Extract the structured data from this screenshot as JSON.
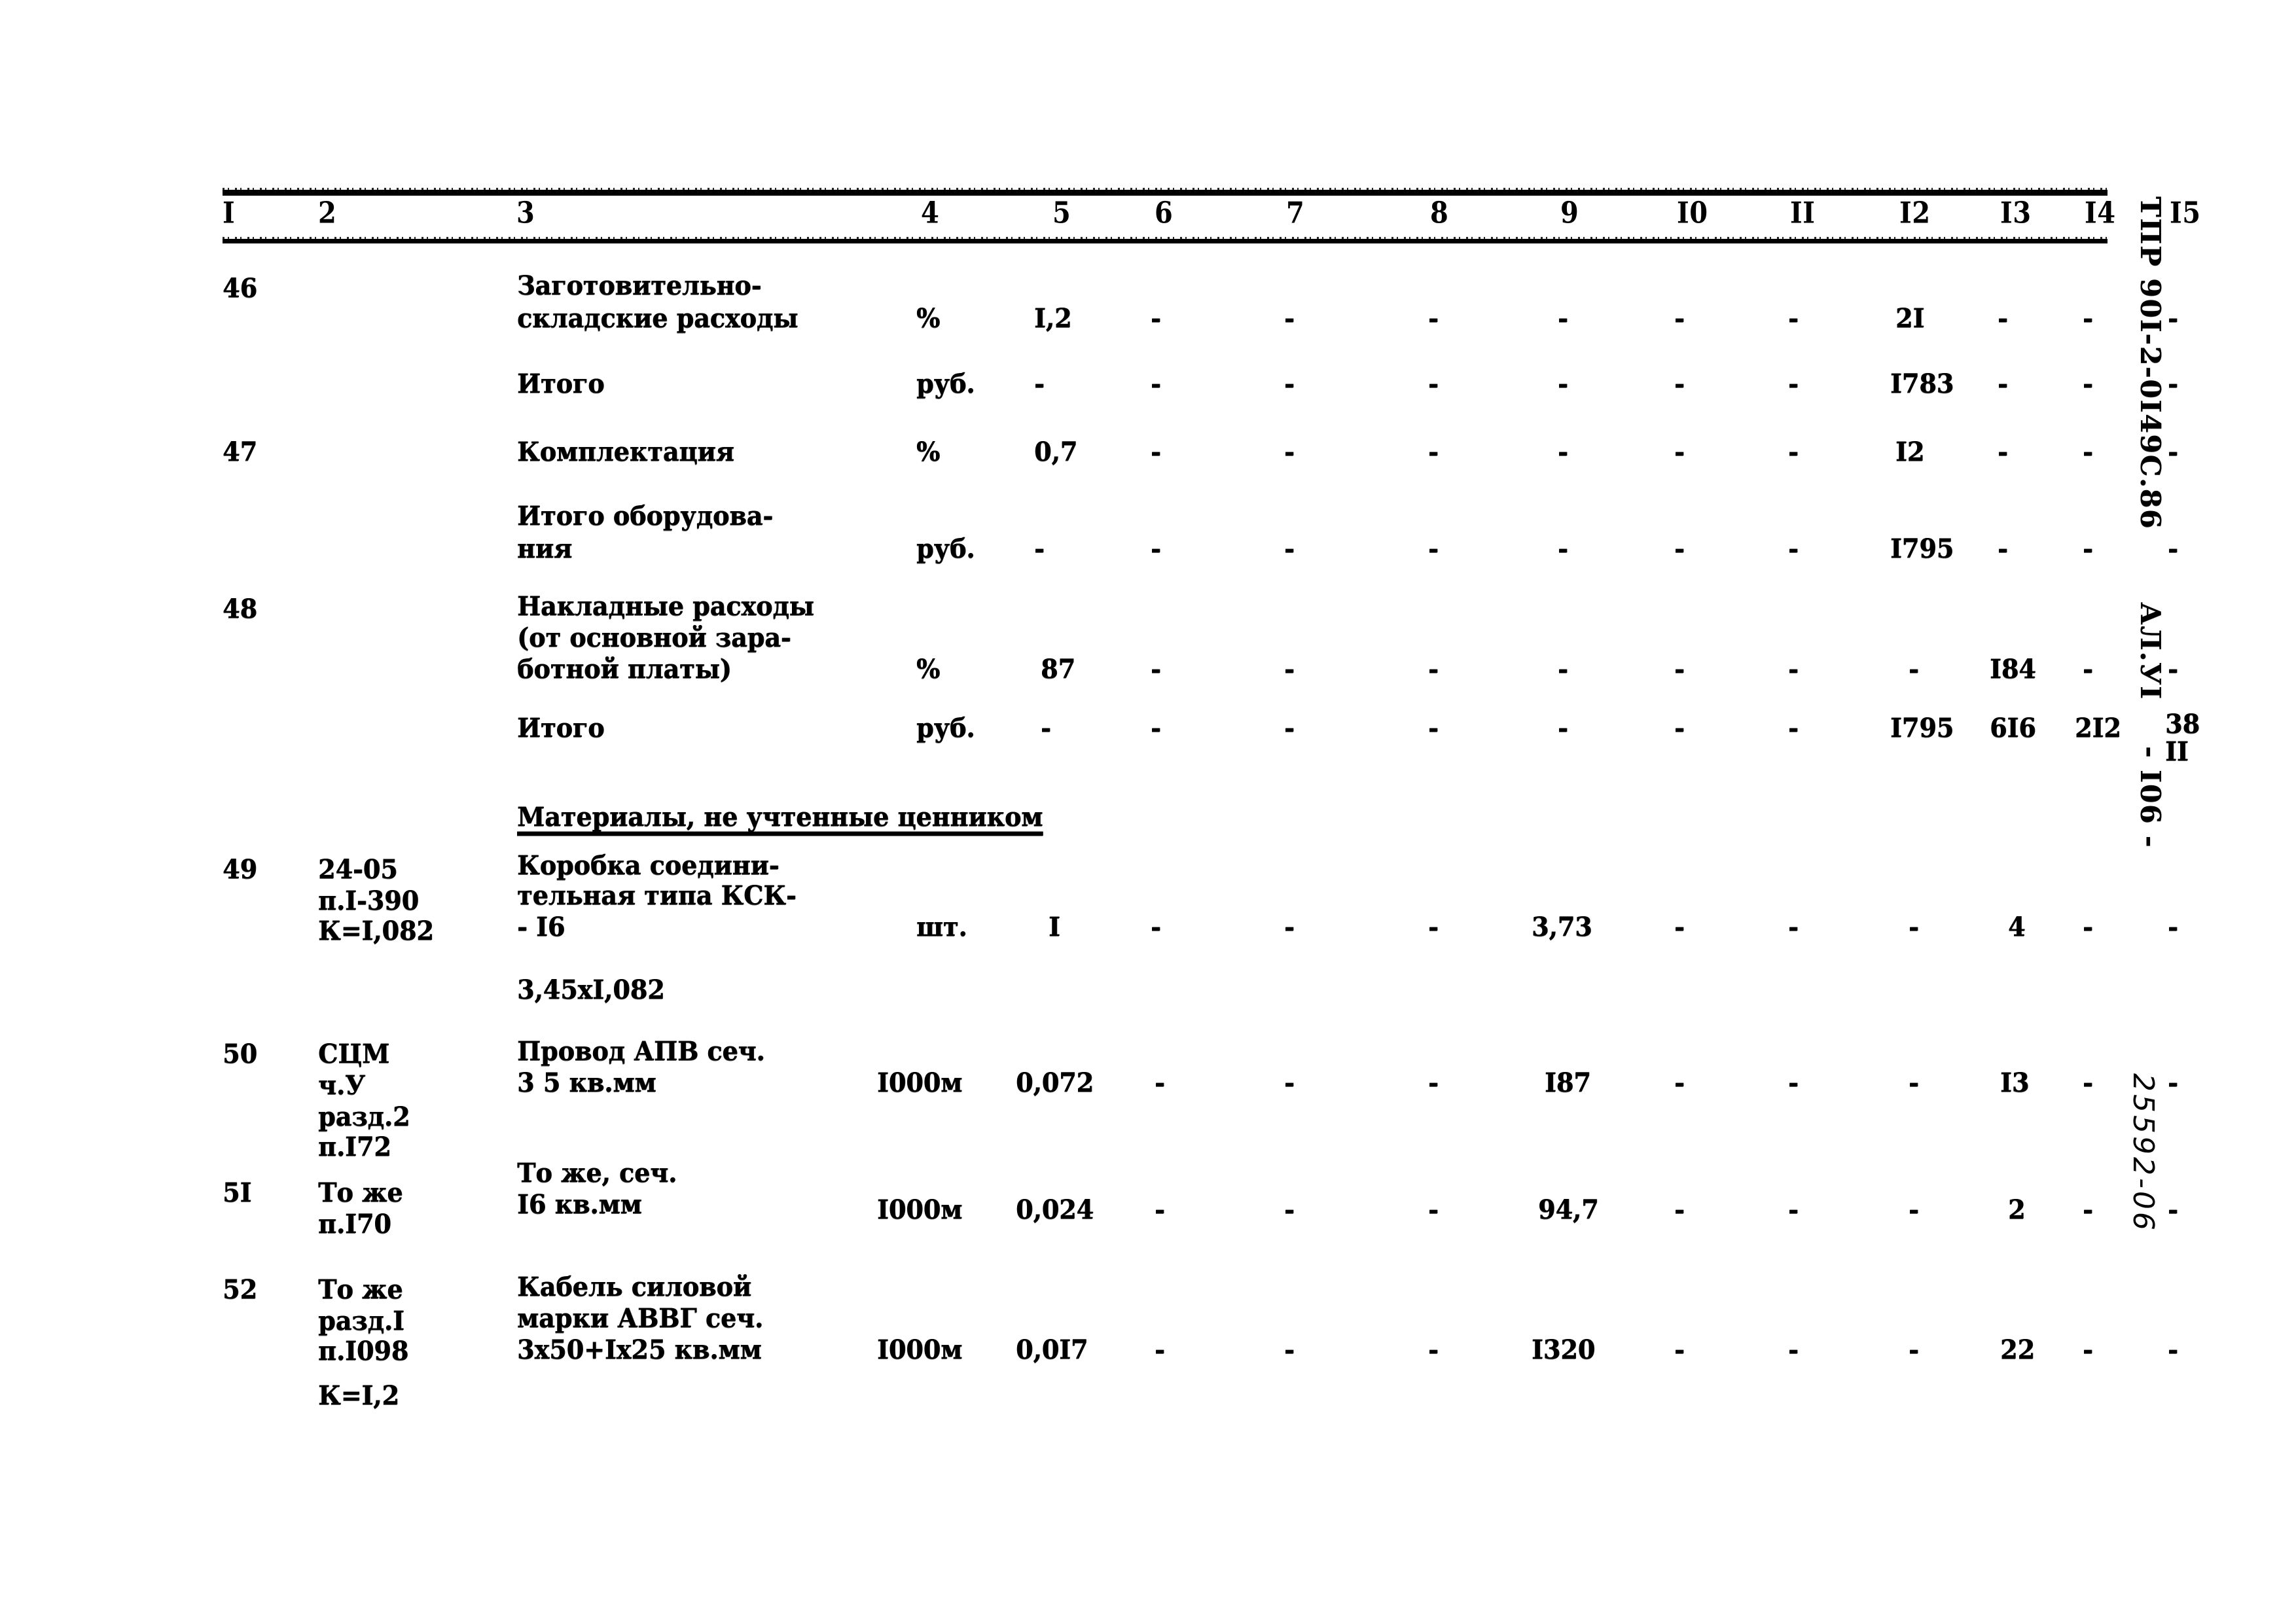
{
  "document": {
    "margin_code": "ТПР 90I-2-0I49С.86",
    "album": "АЛ.УI",
    "page_label": "- I06 -",
    "archive_number": "25592-06"
  },
  "table": {
    "column_headers": [
      "I",
      "2",
      "3",
      "4",
      "5",
      "6",
      "7",
      "8",
      "9",
      "I0",
      "II",
      "I2",
      "I3",
      "I4",
      "I5"
    ],
    "section_heading": "Материалы, не учтенные ценником",
    "rows": [
      {
        "no": "46",
        "code": "",
        "name_lines": [
          "Заготовительно-",
          "складские расходы"
        ],
        "unit": "%",
        "c5": "I,2",
        "c6": "-",
        "c7": "-",
        "c8": "-",
        "c9": "-",
        "c10": "-",
        "c11": "-",
        "c12": "2I",
        "c13": "-",
        "c14": "-",
        "c15": "-"
      },
      {
        "no": "",
        "code": "",
        "name_lines": [
          "Итого"
        ],
        "unit": "руб.",
        "c5": "-",
        "c6": "-",
        "c7": "-",
        "c8": "-",
        "c9": "-",
        "c10": "-",
        "c11": "-",
        "c12": "I783",
        "c13": "-",
        "c14": "-",
        "c15": "-"
      },
      {
        "no": "47",
        "code": "",
        "name_lines": [
          "Комплектация"
        ],
        "unit": "%",
        "c5": "0,7",
        "c6": "-",
        "c7": "-",
        "c8": "-",
        "c9": "-",
        "c10": "-",
        "c11": "-",
        "c12": "I2",
        "c13": "-",
        "c14": "-",
        "c15": "-"
      },
      {
        "no": "",
        "code": "",
        "name_lines": [
          "Итого оборудова-",
          "ния"
        ],
        "unit": "руб.",
        "c5": "-",
        "c6": "-",
        "c7": "-",
        "c8": "-",
        "c9": "-",
        "c10": "-",
        "c11": "-",
        "c12": "I795",
        "c13": "-",
        "c14": "-",
        "c15": "-"
      },
      {
        "no": "48",
        "code": "",
        "name_lines": [
          "Накладные расходы",
          "(от основной зара-",
          "ботной платы)"
        ],
        "unit": "%",
        "c5": "87",
        "c6": "-",
        "c7": "-",
        "c8": "-",
        "c9": "-",
        "c10": "-",
        "c11": "-",
        "c12": "-",
        "c13": "I84",
        "c14": "-",
        "c15": "-"
      },
      {
        "no": "",
        "code": "",
        "name_lines": [
          "Итого"
        ],
        "unit": "руб.",
        "c5": "-",
        "c6": "-",
        "c7": "-",
        "c8": "-",
        "c9": "-",
        "c10": "-",
        "c11": "-",
        "c12": "I795",
        "c13": "6I6",
        "c14": "2I2",
        "c15": "38",
        "c15_second": "II"
      },
      {
        "no": "49",
        "code_lines": [
          "24-05",
          "п.I-390",
          "К=I,082"
        ],
        "name_lines": [
          "Коробка соедини-",
          "тельная типа КСК-",
          "- I6"
        ],
        "name_extra": "3,45xI,082",
        "unit": "шт.",
        "c5": "I",
        "c6": "-",
        "c7": "-",
        "c8": "-",
        "c9": "3,73",
        "c10": "-",
        "c11": "-",
        "c12": "-",
        "c13": "4",
        "c14": "-",
        "c15": "-"
      },
      {
        "no": "50",
        "code_lines": [
          "СЦМ",
          "ч.У",
          "разд.2",
          "п.I72"
        ],
        "name_lines": [
          "Провод АПВ сеч.",
          "3 5 кв.мм"
        ],
        "unit": "I000м",
        "c5": "0,072",
        "c6": "-",
        "c7": "-",
        "c8": "-",
        "c9": "I87",
        "c10": "-",
        "c11": "-",
        "c12": "-",
        "c13": "I3",
        "c14": "-",
        "c15": "-"
      },
      {
        "no": "5I",
        "code_lines": [
          "То же",
          "п.I70"
        ],
        "name_lines": [
          "То же, сеч.",
          "I6 кв.мм"
        ],
        "unit": "I000м",
        "c5": "0,024",
        "c6": "-",
        "c7": "-",
        "c8": "-",
        "c9": "94,7",
        "c10": "-",
        "c11": "-",
        "c12": "-",
        "c13": "2",
        "c14": "-",
        "c15": "-"
      },
      {
        "no": "52",
        "code_lines": [
          "То же",
          "разд.I",
          "п.I098",
          "К=I,2"
        ],
        "name_lines": [
          "Кабель силовой",
          "марки АВВГ сеч.",
          "3х50+Iх25 кв.мм"
        ],
        "unit": "I000м",
        "c5": "0,0I7",
        "c6": "-",
        "c7": "-",
        "c8": "-",
        "c9": "I320",
        "c10": "-",
        "c11": "-",
        "c12": "-",
        "c13": "22",
        "c14": "-",
        "c15": "-"
      }
    ]
  }
}
